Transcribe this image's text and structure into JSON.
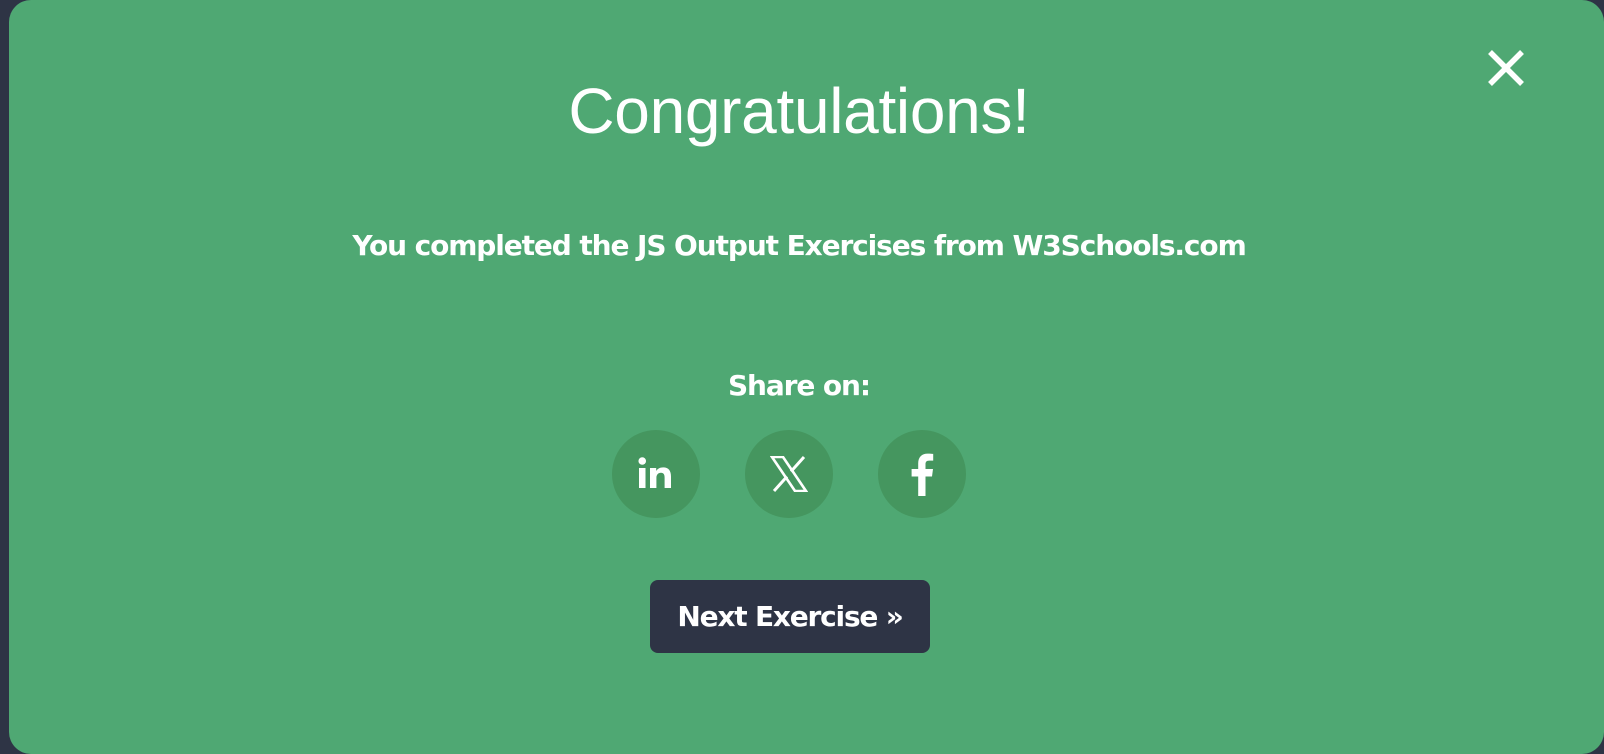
{
  "modal": {
    "title": "Congratulations!",
    "message": "You completed the JS Output Exercises from W3Schools.com",
    "share_label": "Share on:",
    "share_buttons": [
      {
        "icon": "linkedin-icon"
      },
      {
        "icon": "x-icon"
      },
      {
        "icon": "facebook-icon"
      }
    ],
    "next_button_label": "Next Exercise »",
    "close_icon": "close-icon"
  },
  "colors": {
    "modal_background": "#4fa873",
    "share_button_background": "#45965f",
    "next_button_background": "#2e3445",
    "page_background": "#2e3445",
    "text": "#ffffff"
  }
}
